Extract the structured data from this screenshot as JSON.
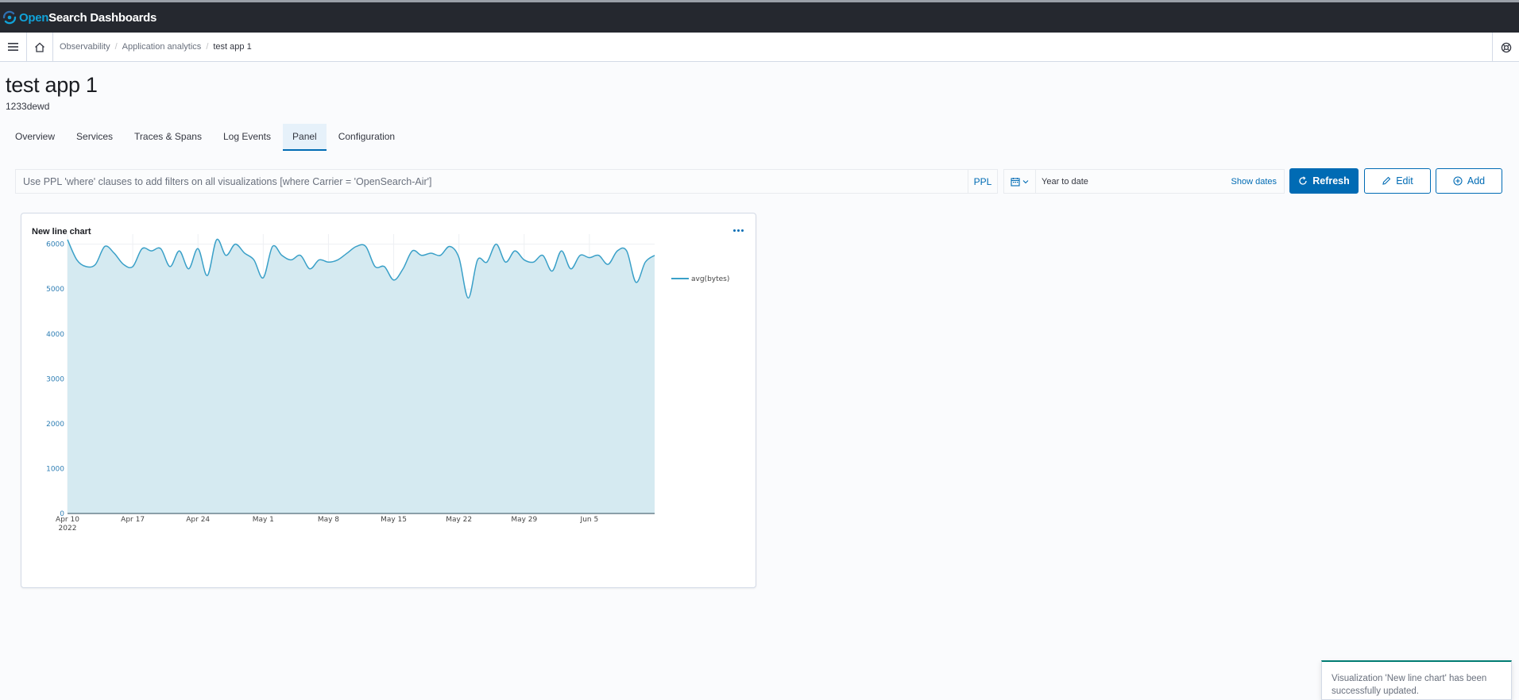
{
  "header": {
    "logo_open": "Open",
    "logo_search": "Search",
    "logo_dashboards": "Dashboards"
  },
  "breadcrumbs": [
    "Observability",
    "Application analytics",
    "test app 1"
  ],
  "page": {
    "title": "test app 1",
    "subtitle": "1233dewd"
  },
  "tabs": [
    {
      "label": "Overview",
      "active": false
    },
    {
      "label": "Services",
      "active": false
    },
    {
      "label": "Traces & Spans",
      "active": false
    },
    {
      "label": "Log Events",
      "active": false
    },
    {
      "label": "Panel",
      "active": true
    },
    {
      "label": "Configuration",
      "active": false
    }
  ],
  "search": {
    "placeholder": "Use PPL 'where' clauses to add filters on all visualizations [where Carrier = 'OpenSearch-Air']",
    "language_label": "PPL"
  },
  "date_picker": {
    "range": "Year to date",
    "show_dates_label": "Show dates"
  },
  "buttons": {
    "refresh": "Refresh",
    "edit": "Edit",
    "add": "Add"
  },
  "panel": {
    "title": "New line chart"
  },
  "toast": {
    "message": "Visualization 'New line chart' has been successfully updated."
  },
  "colors": {
    "accent": "#006bb4",
    "series_line": "#3aa0c8",
    "series_fill": "#d5eaf1",
    "header_bg": "#25282f",
    "logo_blue": "#11a2d8"
  },
  "chart_data": {
    "type": "area",
    "title": "New line chart",
    "xlabel": "",
    "ylabel": "",
    "x_ticks": [
      "Apr 10\n2022",
      "Apr 17",
      "Apr 24",
      "May 1",
      "May 8",
      "May 15",
      "May 22",
      "May 29",
      "Jun 5"
    ],
    "y_ticks": [
      0,
      1000,
      2000,
      3000,
      4000,
      5000,
      6000
    ],
    "ylim": [
      0,
      6400
    ],
    "xlim": [
      "2022-04-10",
      "2022-06-10"
    ],
    "legend_position": "top-right",
    "grid": true,
    "series": [
      {
        "name": "avg(bytes)",
        "points": [
          [
            "2022-04-10",
            6100
          ],
          [
            "2022-04-11",
            5650
          ],
          [
            "2022-04-12",
            5500
          ],
          [
            "2022-04-13",
            5550
          ],
          [
            "2022-04-14",
            5950
          ],
          [
            "2022-04-15",
            5800
          ],
          [
            "2022-04-16",
            5550
          ],
          [
            "2022-04-17",
            5500
          ],
          [
            "2022-04-18",
            5900
          ],
          [
            "2022-04-19",
            5850
          ],
          [
            "2022-04-20",
            5900
          ],
          [
            "2022-04-21",
            5500
          ],
          [
            "2022-04-22",
            5850
          ],
          [
            "2022-04-23",
            5450
          ],
          [
            "2022-04-24",
            5900
          ],
          [
            "2022-04-25",
            5300
          ],
          [
            "2022-04-26",
            6100
          ],
          [
            "2022-04-27",
            5750
          ],
          [
            "2022-04-28",
            6000
          ],
          [
            "2022-04-29",
            5800
          ],
          [
            "2022-04-30",
            5650
          ],
          [
            "2022-05-01",
            5250
          ],
          [
            "2022-05-02",
            5950
          ],
          [
            "2022-05-03",
            5750
          ],
          [
            "2022-05-04",
            5650
          ],
          [
            "2022-05-05",
            5750
          ],
          [
            "2022-05-06",
            5450
          ],
          [
            "2022-05-07",
            5650
          ],
          [
            "2022-05-08",
            5600
          ],
          [
            "2022-05-09",
            5650
          ],
          [
            "2022-05-10",
            5800
          ],
          [
            "2022-05-11",
            5950
          ],
          [
            "2022-05-12",
            5950
          ],
          [
            "2022-05-13",
            5500
          ],
          [
            "2022-05-14",
            5500
          ],
          [
            "2022-05-15",
            5200
          ],
          [
            "2022-05-16",
            5450
          ],
          [
            "2022-05-17",
            5850
          ],
          [
            "2022-05-18",
            5750
          ],
          [
            "2022-05-19",
            5800
          ],
          [
            "2022-05-20",
            5750
          ],
          [
            "2022-05-21",
            5950
          ],
          [
            "2022-05-22",
            5700
          ],
          [
            "2022-05-23",
            4800
          ],
          [
            "2022-05-24",
            5650
          ],
          [
            "2022-05-25",
            5600
          ],
          [
            "2022-05-26",
            6000
          ],
          [
            "2022-05-27",
            5600
          ],
          [
            "2022-05-28",
            5850
          ],
          [
            "2022-05-29",
            5650
          ],
          [
            "2022-05-30",
            5600
          ],
          [
            "2022-05-31",
            5750
          ],
          [
            "2022-06-01",
            5400
          ],
          [
            "2022-06-02",
            5850
          ],
          [
            "2022-06-03",
            5450
          ],
          [
            "2022-06-04",
            5750
          ],
          [
            "2022-06-05",
            5700
          ],
          [
            "2022-06-06",
            5750
          ],
          [
            "2022-06-07",
            5550
          ],
          [
            "2022-06-08",
            5850
          ],
          [
            "2022-06-09",
            5850
          ],
          [
            "2022-06-10",
            5150
          ],
          [
            "2022-06-11",
            5600
          ],
          [
            "2022-06-12",
            5750
          ]
        ]
      }
    ]
  }
}
